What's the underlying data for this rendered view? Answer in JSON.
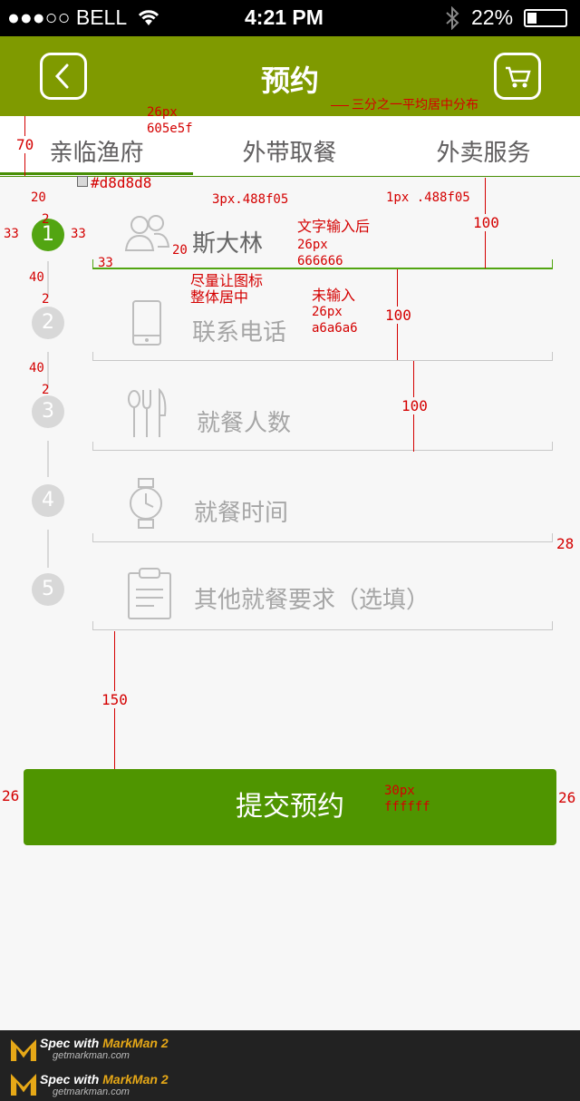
{
  "status": {
    "carrier": "●●●○○ BELL",
    "time": "4:21 PM",
    "battery": "22%"
  },
  "nav": {
    "title": "预约",
    "back_icon": "chevron-left-icon",
    "cart_icon": "cart-icon"
  },
  "tabs": [
    "亲临渔府",
    "外带取餐",
    "外卖服务"
  ],
  "rows": [
    {
      "num": "1",
      "label": "斯大林",
      "icon": "people-icon"
    },
    {
      "num": "2",
      "label": "联系电话",
      "icon": "phone-icon"
    },
    {
      "num": "3",
      "label": "就餐人数",
      "icon": "utensils-icon"
    },
    {
      "num": "4",
      "label": "就餐时间",
      "icon": "watch-icon"
    },
    {
      "num": "5",
      "label": "其他就餐要求（选填）",
      "icon": "clipboard-icon"
    }
  ],
  "submit": "提交预约",
  "annotations": {
    "tab_note": "三分之一平均居中分布",
    "tab_size": "26px",
    "tab_color": "605e5f",
    "h70": "70",
    "color_d8": "#d8d8d8",
    "u20": "20",
    "u2": "2",
    "u40": "40",
    "u33": "33",
    "u20b": "20",
    "u100": "100",
    "u150": "150",
    "u28": "28",
    "u26": "26",
    "line3": "3px.488f05",
    "line1": "1px .488f05",
    "input_after": "文字输入后",
    "input_after_size": "26px",
    "input_after_color": "666666",
    "not_input": "未输入",
    "not_input_size": "26px",
    "not_input_color": "a6a6a6",
    "icon_center_1": "尽量让图标",
    "icon_center_2": "整体居中",
    "submit_size": "30px",
    "submit_color": "ffffff"
  },
  "footer": {
    "spec": "Spec with",
    "brand": "MarkMan 2",
    "site": "getmarkman.com"
  },
  "colors": {
    "nav": "#7f9a00",
    "accent": "#488f05",
    "submit": "#4f9500",
    "active_step": "#52a512",
    "annotation": "#d40000"
  }
}
